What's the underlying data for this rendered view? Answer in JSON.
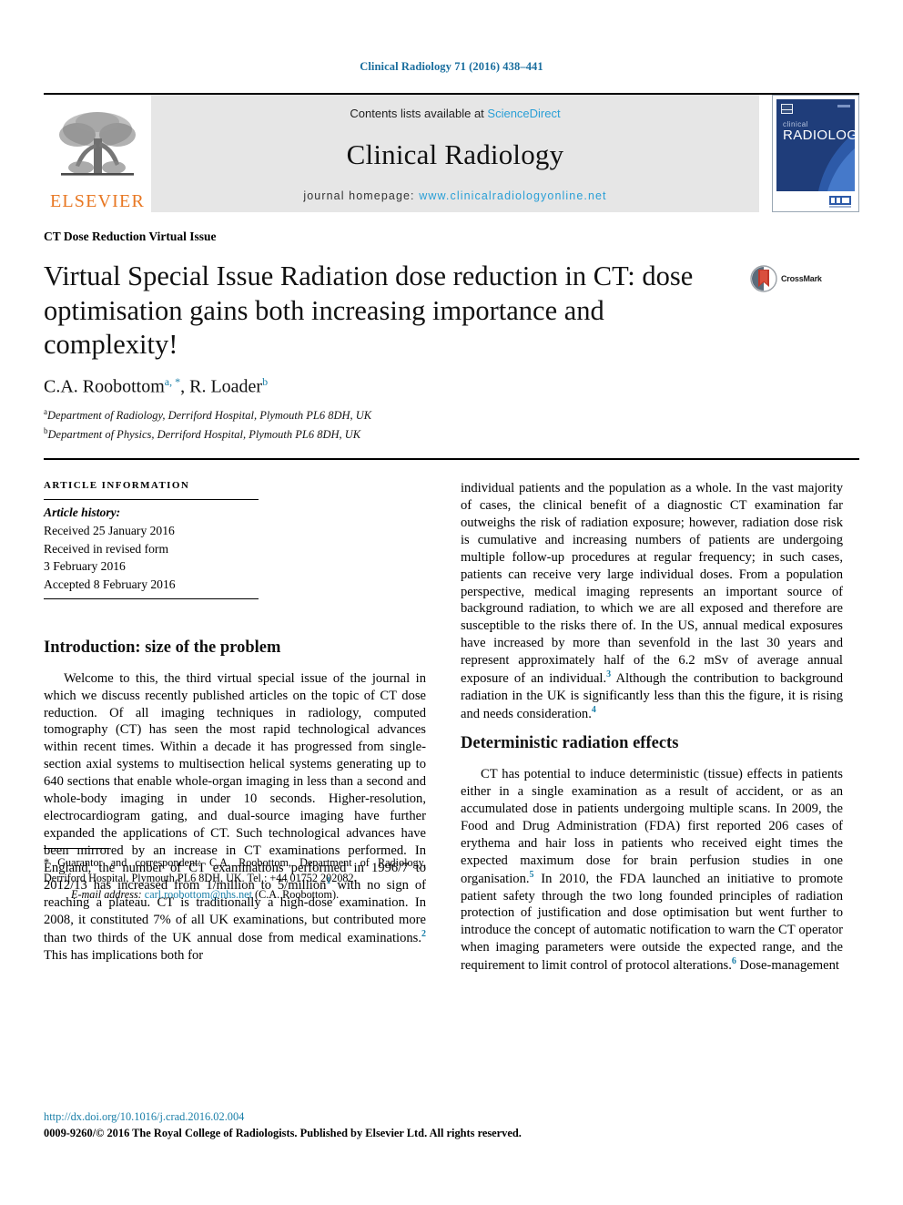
{
  "running_head": "Clinical Radiology 71 (2016) 438–441",
  "masthead": {
    "publisher_name": "ELSEVIER",
    "contents_prefix": "Contents lists available at ",
    "contents_link": "ScienceDirect",
    "journal_name": "Clinical Radiology",
    "homepage_prefix": "journal homepage: ",
    "homepage_url": "www.clinicalradiologyonline.net",
    "cover_title_small": "clinical",
    "cover_title_large": "RADIOLOGY"
  },
  "section_label": "CT Dose Reduction Virtual Issue",
  "title": "Virtual Special Issue Radiation dose reduction in CT: dose optimisation gains both increasing importance and complexity!",
  "crossmark_label": "CrossMark",
  "authors": {
    "author1_name": "C.A. Roobottom",
    "author1_sup": "a",
    "author1_star": ", *",
    "separator": ", ",
    "author2_name": "R. Loader",
    "author2_sup": "b"
  },
  "affiliations": [
    {
      "marker": "a",
      "text": "Department of Radiology, Derriford Hospital, Plymouth PL6 8DH, UK"
    },
    {
      "marker": "b",
      "text": "Department of Physics, Derriford Hospital, Plymouth PL6 8DH, UK"
    }
  ],
  "article_information": {
    "heading": "ARTICLE INFORMATION",
    "history_label": "Article history:",
    "lines": [
      "Received 25 January 2016",
      "Received in revised form",
      "3 February 2016",
      "Accepted 8 February 2016"
    ]
  },
  "left_column": {
    "heading": "Introduction: size of the problem",
    "para_part1": "Welcome to this, the third virtual special issue of the journal in which we discuss recently published articles on the topic of CT dose reduction. Of all imaging techniques in radiology, computed tomography (CT) has seen the most rapid technological advances within recent times. Within a decade it has progressed from single-section axial systems to multisection helical systems generating up to 640 sections that enable whole-organ imaging in less than a second and whole-body imaging in under 10 seconds. Higher-resolution, electrocardiogram gating, and dual-source imaging have further expanded the applications of CT. Such technological advances have been mirrored by an increase in CT examinations performed. In England, the number of CT examinations performed in 1996/7 to 2012/13 has increased from 1/million to 5/million",
    "ref1": "1",
    "para_part2": " with no sign of reaching a plateau. CT is traditionally a high-dose examination. In 2008, it constituted 7% of all UK examinations, but contributed more than two thirds of the UK annual dose from medical examinations.",
    "ref2": "2",
    "para_part3": " This has implications both for"
  },
  "footnote": {
    "star": "*",
    "correspondent": " Guarantor and correspondent: C.A. Roobottom, Department of Radiology, Derriford Hospital, Plymouth PL6 8DH, UK. Tel.: +44 01752 202082.",
    "email_label": "E-mail address:",
    "email": "carl.roobottom@nhs.net",
    "email_suffix": " (C.A. Roobottom)."
  },
  "right_column": {
    "para1_part1": "individual patients and the population as a whole. In the vast majority of cases, the clinical benefit of a diagnostic CT examination far outweighs the risk of radiation exposure; however, radiation dose risk is cumulative and increasing numbers of patients are undergoing multiple follow-up procedures at regular frequency; in such cases, patients can receive very large individual doses. From a population perspective, medical imaging represents an important source of background radiation, to which we are all exposed and therefore are susceptible to the risks there of. In the US, annual medical exposures have increased by more than sevenfold in the last 30 years and represent approximately half of the 6.2 mSv of average annual exposure of an individual.",
    "ref3": "3",
    "para1_part2": " Although the contribution to background radiation in the UK is significantly less than this the figure, it is rising and needs consideration.",
    "ref4": "4",
    "heading": "Deterministic radiation effects",
    "para2_part1": "CT has potential to induce deterministic (tissue) effects in patients either in a single examination as a result of accident, or as an accumulated dose in patients undergoing multiple scans. In 2009, the Food and Drug Administration (FDA) first reported 206 cases of erythema and hair loss in patients who received eight times the expected maximum dose for brain perfusion studies in one organisation.",
    "ref5": "5",
    "para2_part2": " In 2010, the FDA launched an initiative to promote patient safety through the two long founded principles of radiation protection of justification and dose optimisation but went further to introduce the concept of automatic notification to warn the CT operator when imaging parameters were outside the expected range, and the requirement to limit control of protocol alterations.",
    "ref6": "6",
    "para2_part3": " Dose-management"
  },
  "footer": {
    "doi": "http://dx.doi.org/10.1016/j.crad.2016.02.004",
    "copyright": "0009-9260/© 2016 The Royal College of Radiologists. Published by Elsevier Ltd. All rights reserved."
  },
  "colors": {
    "link_blue": "#1a7fa8",
    "sciencedirect_blue": "#2a9fd6",
    "elsevier_orange": "#E87722",
    "masthead_grey": "#e6e6e6",
    "cover_navy": "#1f3d7a"
  }
}
